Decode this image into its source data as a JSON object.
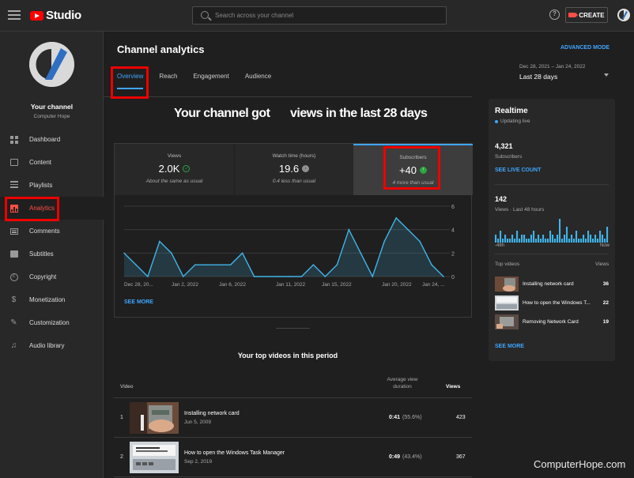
{
  "topbar": {
    "brand": "Studio",
    "search_placeholder": "Search across your channel",
    "help_icon": "?",
    "create_label": "CREATE"
  },
  "sidebar": {
    "channel_title": "Your channel",
    "channel_name": "Computer Hope",
    "items": [
      {
        "label": "Dashboard",
        "icon": "dashboard-icon"
      },
      {
        "label": "Content",
        "icon": "content-icon"
      },
      {
        "label": "Playlists",
        "icon": "playlists-icon"
      },
      {
        "label": "Analytics",
        "icon": "analytics-icon",
        "active": true
      },
      {
        "label": "Comments",
        "icon": "comments-icon"
      },
      {
        "label": "Subtitles",
        "icon": "subtitles-icon"
      },
      {
        "label": "Copyright",
        "icon": "copyright-icon"
      },
      {
        "label": "Monetization",
        "icon": "monetization-icon"
      },
      {
        "label": "Customization",
        "icon": "customization-icon"
      },
      {
        "label": "Audio library",
        "icon": "audio-library-icon"
      }
    ]
  },
  "main": {
    "title": "Channel analytics",
    "advanced_mode": "ADVANCED MODE",
    "tabs": [
      "Overview",
      "Reach",
      "Engagement",
      "Audience"
    ],
    "date_range": {
      "range": "Dec 28, 2021 – Jan 24, 2022",
      "label": "Last 28 days"
    },
    "headline_a": "Your channel got",
    "headline_b": "views in the last 28 days",
    "metrics": [
      {
        "label": "Views",
        "value": "2.0K",
        "note": "About the same as usual",
        "icon": "check-icon"
      },
      {
        "label": "Watch time (hours)",
        "value": "19.6",
        "note": "0.4 less than usual",
        "icon": "arrow-down-icon"
      },
      {
        "label": "Subscribers",
        "value": "+40",
        "note": "4 more than usual",
        "icon": "arrow-up-icon"
      }
    ],
    "see_more": "SEE MORE",
    "top_videos_title": "Your top videos in this period",
    "table_headers": {
      "video": "Video",
      "duration_line1": "Average view",
      "duration_line2": "duration",
      "views": "Views"
    },
    "rows": [
      {
        "rank": "1",
        "title": "Installing network card",
        "date": "Jun 5, 2009",
        "duration": "0:41",
        "percent": "(55.6%)",
        "views": "423"
      },
      {
        "rank": "2",
        "title": "How to open the Windows Task Manager",
        "date": "Sep 2, 2019",
        "duration": "0:49",
        "percent": "(43.4%)",
        "views": "367"
      }
    ]
  },
  "chart_data": {
    "type": "area",
    "x_tick_labels": [
      "Dec 28, 20...",
      "Jan 2, 2022",
      "Jan 6, 2022",
      "Jan 11, 2022",
      "Jan 15, 2022",
      "Jan 20, 2022",
      "Jan 24, ..."
    ],
    "y_ticks": [
      0,
      2,
      4,
      6
    ],
    "ylim": [
      0,
      6
    ],
    "series": [
      {
        "values": [
          2,
          1,
          0,
          3,
          2,
          0,
          1,
          1,
          1,
          1,
          2,
          0,
          0,
          0,
          0,
          0,
          1,
          0,
          1,
          4,
          2,
          0,
          3,
          5,
          4,
          3,
          1,
          0
        ]
      }
    ],
    "color": "#41b4e8"
  },
  "realtime": {
    "title": "Realtime",
    "status": "Updating live",
    "subs_value": "4,321",
    "subs_label": "Subscribers",
    "live_link": "SEE LIVE COUNT",
    "views_value": "142",
    "views_label": "Views · Last 48 hours",
    "axis_left": "-48h",
    "axis_right": "Now",
    "top_label": "Top videos",
    "views_col": "Views",
    "bars": [
      2,
      1,
      3,
      1,
      2,
      1,
      1,
      2,
      1,
      3,
      1,
      2,
      2,
      1,
      1,
      2,
      3,
      1,
      2,
      1,
      2,
      1,
      1,
      3,
      2,
      1,
      2,
      6,
      1,
      2,
      4,
      1,
      2,
      1,
      3,
      1,
      1,
      2,
      1,
      3,
      2,
      1,
      2,
      1,
      3,
      2,
      1,
      4
    ],
    "items": [
      {
        "title": "Installing network card",
        "views": "36"
      },
      {
        "title": "How to open the Windows T...",
        "views": "22"
      },
      {
        "title": "Removing Network Card",
        "views": "19"
      }
    ],
    "see_more": "SEE MORE"
  },
  "watermark": "ComputerHope.com"
}
